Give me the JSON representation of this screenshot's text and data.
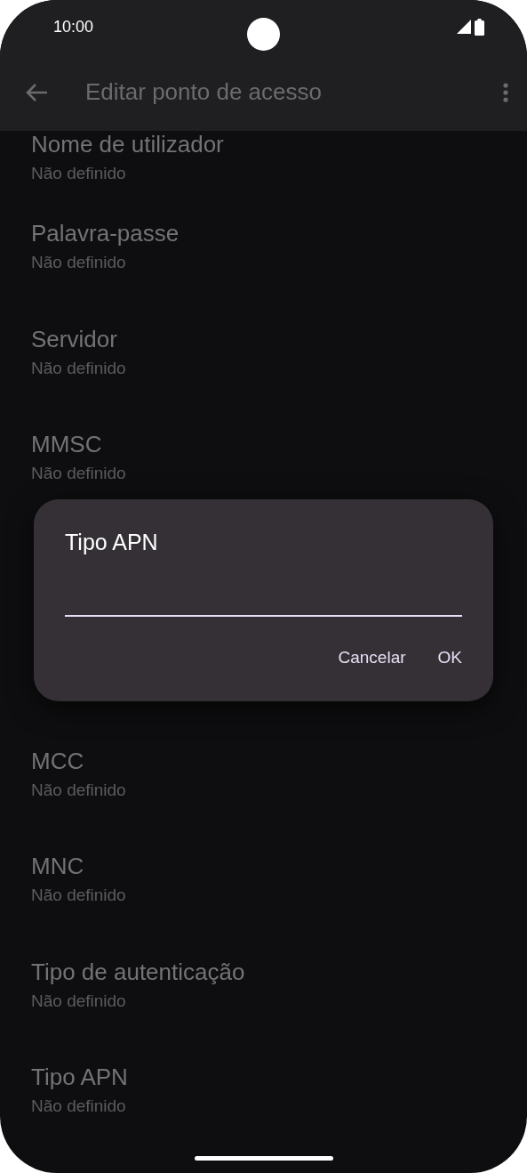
{
  "status_bar": {
    "time": "10:00"
  },
  "app_bar": {
    "title": "Editar ponto de acesso"
  },
  "settings_top": [
    {
      "title": "Nome de utilizador",
      "value": "Não definido"
    },
    {
      "title": "Palavra-passe",
      "value": "Não definido"
    },
    {
      "title": "Servidor",
      "value": "Não definido"
    },
    {
      "title": "MMSC",
      "value": "Não definido"
    }
  ],
  "settings_bottom": [
    {
      "title": "MCC",
      "value": "Não definido"
    },
    {
      "title": "MNC",
      "value": "Não definido"
    },
    {
      "title": "Tipo de autenticação",
      "value": "Não definido"
    },
    {
      "title": "Tipo APN",
      "value": "Não definido"
    }
  ],
  "dialog": {
    "title": "Tipo APN",
    "input_focused": true,
    "buttons": [
      "Cancelar",
      "OK"
    ]
  }
}
